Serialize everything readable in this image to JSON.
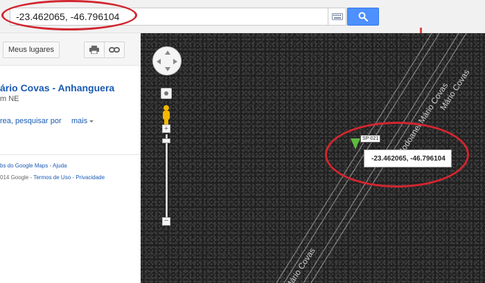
{
  "search": {
    "value": "-23.462065, -46.796104"
  },
  "left_panel": {
    "my_places_label": "Meus lugares",
    "place_title": "ário Covas - Anhanguera",
    "place_subtitle": "m NE",
    "place_actions": "rea, pesquisar por",
    "more_label": "mais",
    "footer_line1_prefix": "bs do Google Maps",
    "footer_line1_sep": " - ",
    "footer_line1_link": "Ajuda",
    "footer_line2_prefix": "014 Google - ",
    "footer_terms": "Termos de Uso",
    "footer_sep2": " - ",
    "footer_privacy": "Privacidade"
  },
  "map": {
    "road_labels": [
      "Rodoanel Mário Covas",
      "Mário Covas",
      "Mário Covas"
    ],
    "shield_label": "SP-021",
    "coord_box_text": "-23.462065, -46.796104",
    "controls": {
      "zoom_plus": "+",
      "zoom_minus": "−"
    }
  },
  "icons": [
    "keyboard-icon",
    "search-icon",
    "print-icon",
    "link-icon",
    "pan-control-icon",
    "pegman-icon",
    "map-pin-icon"
  ],
  "colors": {
    "search_button": "#4d90fe",
    "link": "#1a5ab3",
    "annotation": "#d22630",
    "pin": "#5dbb3f",
    "pegman": "#f5b700"
  }
}
